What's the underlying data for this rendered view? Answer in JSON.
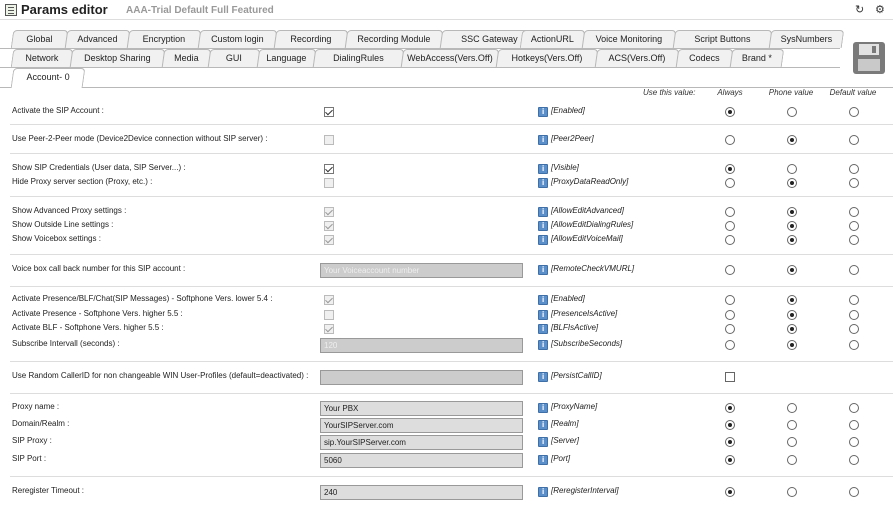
{
  "window": {
    "title": "Params editor",
    "subtitle": "AAA-Trial Default Full Featured"
  },
  "tabs_row1": [
    "Global",
    "Advanced",
    "Encryption",
    "Custom login",
    "Recording",
    "Recording Module",
    "SSC Gateway",
    "ActionURL",
    "Voice Monitoring",
    "Script Buttons",
    "SysNumbers"
  ],
  "tabs_row2": [
    "Network",
    "Desktop Sharing",
    "Media",
    "GUI",
    "Language",
    "DialingRules",
    "WebAccess(Vers.Off)",
    "Hotkeys(Vers.Off)",
    "ACS(Vers.Off)",
    "Codecs",
    "Brand *"
  ],
  "tabs_row3": [
    "Account- 0"
  ],
  "columns": {
    "use_this": "Use this value:",
    "always": "Always",
    "phone": "Phone value",
    "default": "Default value"
  },
  "rows": [
    {
      "label": "Activate the SIP Account :",
      "control": "checkbox",
      "checked": true,
      "disabled": false,
      "key": "[Enabled]",
      "choice": "always"
    },
    {
      "label": "Use Peer-2-Peer mode (Device2Device connection without SIP server) :",
      "control": "checkbox",
      "checked": false,
      "disabled": true,
      "key": "[Peer2Peer]",
      "choice": "phone"
    },
    {
      "label": "Show SIP Credentials (User data, SIP Server...) :",
      "control": "checkbox",
      "checked": true,
      "disabled": false,
      "key": "[Visible]",
      "choice": "always"
    },
    {
      "label": "Hide Proxy server section (Proxy, etc.) :",
      "control": "checkbox",
      "checked": false,
      "disabled": true,
      "key": "[ProxyDataReadOnly]",
      "choice": "phone"
    },
    {
      "label": "Show Advanced Proxy settings :",
      "control": "checkbox",
      "checked": true,
      "disabled": true,
      "key": "[AllowEditAdvanced]",
      "choice": "phone"
    },
    {
      "label": "Show Outside Line settings :",
      "control": "checkbox",
      "checked": true,
      "disabled": true,
      "key": "[AllowEditDialingRules]",
      "choice": "phone"
    },
    {
      "label": "Show Voicebox settings :",
      "control": "checkbox",
      "checked": true,
      "disabled": true,
      "key": "[AllowEditVoiceMail]",
      "choice": "phone"
    },
    {
      "label": "Voice box call back number for this SIP account :",
      "control": "input",
      "value": "Your Voiceaccount number",
      "disabled": true,
      "key": "[RemoteCheckVMURL]",
      "choice": "phone"
    },
    {
      "label": "Activate Presence/BLF/Chat(SIP Messages) - Softphone Vers. lower 5.4 :",
      "control": "checkbox",
      "checked": true,
      "disabled": true,
      "key": "[Enabled]",
      "choice": "phone"
    },
    {
      "label": "Activate Presence - Softphone Vers. higher 5.5 :",
      "control": "checkbox",
      "checked": false,
      "disabled": true,
      "key": "[PresenceIsActive]",
      "choice": "phone"
    },
    {
      "label": "Activate BLF - Softphone Vers. higher 5.5 :",
      "control": "checkbox",
      "checked": true,
      "disabled": true,
      "key": "[BLFIsActive]",
      "choice": "phone"
    },
    {
      "label": "Subscribe Intervall (seconds) :",
      "control": "input",
      "value": "120",
      "disabled": true,
      "key": "[SubscribeSeconds]",
      "choice": "phone"
    },
    {
      "label": "Use Random CallerID for non changeable WIN User-Profiles (default=deactivated) :",
      "control": "input",
      "value": "",
      "disabled": true,
      "key": "[PersistCallID]",
      "choice": "checkbox"
    },
    {
      "label": "Proxy name :",
      "control": "input",
      "value": "Your PBX",
      "disabled": false,
      "key": "[ProxyName]",
      "choice": "always"
    },
    {
      "label": "Domain/Realm :",
      "control": "input",
      "value": "YourSIPServer.com",
      "disabled": false,
      "key": "[Realm]",
      "choice": "always"
    },
    {
      "label": "SIP Proxy :",
      "control": "input",
      "value": "sip.YourSIPServer.com",
      "disabled": false,
      "key": "[Server]",
      "choice": "always"
    },
    {
      "label": "SIP Port :",
      "control": "input",
      "value": "5060",
      "disabled": false,
      "key": "[Port]",
      "choice": "always"
    },
    {
      "label": "Reregister Timeout :",
      "control": "input",
      "value": "240",
      "disabled": false,
      "key": "[ReregisterInterval]",
      "choice": "always"
    }
  ]
}
